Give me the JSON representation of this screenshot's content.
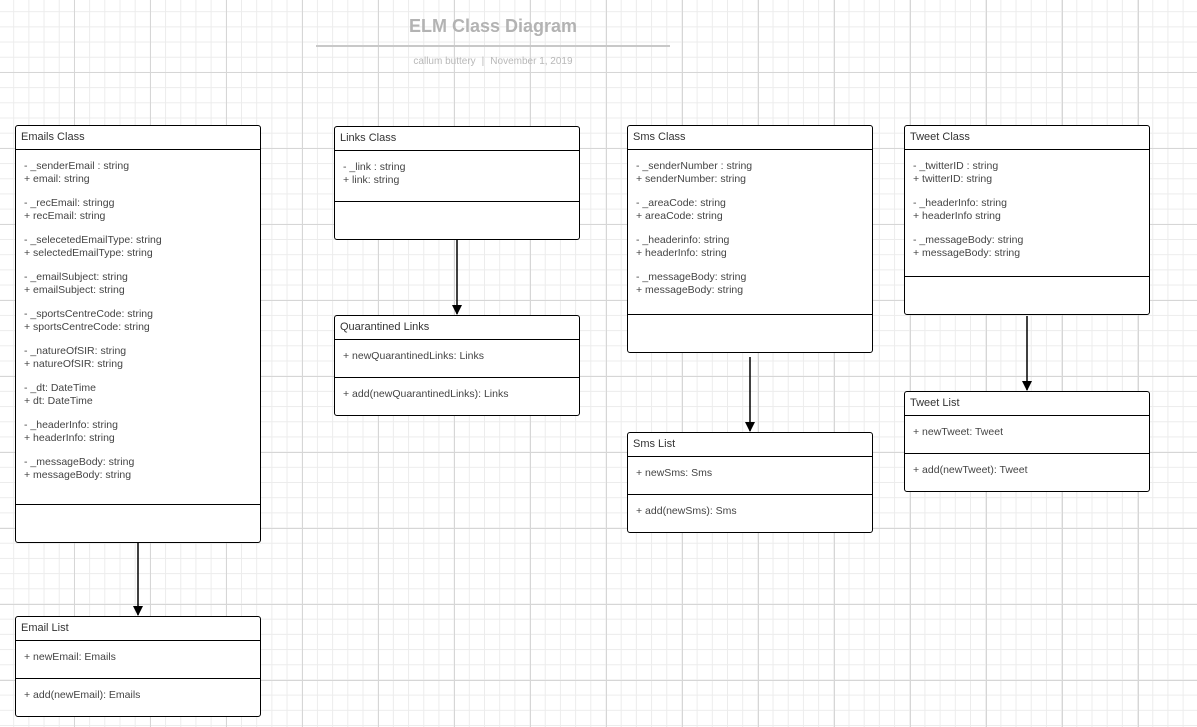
{
  "header": {
    "title": "ELM Class Diagram",
    "author": "callum buttery",
    "separator": "|",
    "date": "November 1, 2019"
  },
  "classes": {
    "emails": {
      "name": "Emails Class",
      "groups": [
        [
          "- _senderEmail : string",
          "+ email: string"
        ],
        [
          "- _recEmail: stringg",
          "+ recEmail: string"
        ],
        [
          "- _selecetedEmailType: string",
          "+ selectedEmailType: string"
        ],
        [
          "- _emailSubject: string",
          "+ emailSubject: string"
        ],
        [
          "- _sportsCentreCode: string",
          "+ sportsCentreCode: string"
        ],
        [
          "- _natureOfSIR: string",
          "+ natureOfSIR: string"
        ],
        [
          "- _dt: DateTime",
          "+ dt: DateTime"
        ],
        [
          "- _headerInfo: string",
          "+ headerInfo: string"
        ],
        [
          "- _messageBody: string",
          "+ messageBody: string"
        ]
      ],
      "methods": []
    },
    "email_list": {
      "name": "Email List",
      "groups": [
        [
          "+ newEmail: Emails"
        ]
      ],
      "methods": [
        "+ add(newEmail): Emails"
      ]
    },
    "links": {
      "name": "Links Class",
      "groups": [
        [
          "- _link : string",
          "+ link: string"
        ]
      ],
      "methods": []
    },
    "quarantined_links": {
      "name": "Quarantined Links",
      "groups": [
        [
          "+ newQuarantinedLinks: Links"
        ]
      ],
      "methods": [
        "+ add(newQuarantinedLinks): Links"
      ]
    },
    "sms": {
      "name": "Sms Class",
      "groups": [
        [
          "- _senderNumber : string",
          "+ senderNumber: string"
        ],
        [
          "- _areaCode: string",
          "+ areaCode: string"
        ],
        [
          "- _headerinfo: string",
          "+ headerInfo: string"
        ],
        [
          "- _messageBody: string",
          "+ messageBody: string"
        ]
      ],
      "methods": []
    },
    "sms_list": {
      "name": "Sms List",
      "groups": [
        [
          "+ newSms: Sms"
        ]
      ],
      "methods": [
        "+ add(newSms): Sms"
      ]
    },
    "tweet": {
      "name": "Tweet Class",
      "groups": [
        [
          "- _twitterID : string",
          "+ twitterID: string"
        ],
        [
          "- _headerInfo: string",
          "+ headerInfo string"
        ],
        [
          "- _messageBody: string",
          "+ messageBody: string"
        ]
      ],
      "methods": []
    },
    "tweet_list": {
      "name": "Tweet List",
      "groups": [
        [
          "+ newTweet: Tweet"
        ]
      ],
      "methods": [
        "+ add(newTweet): Tweet"
      ]
    }
  }
}
